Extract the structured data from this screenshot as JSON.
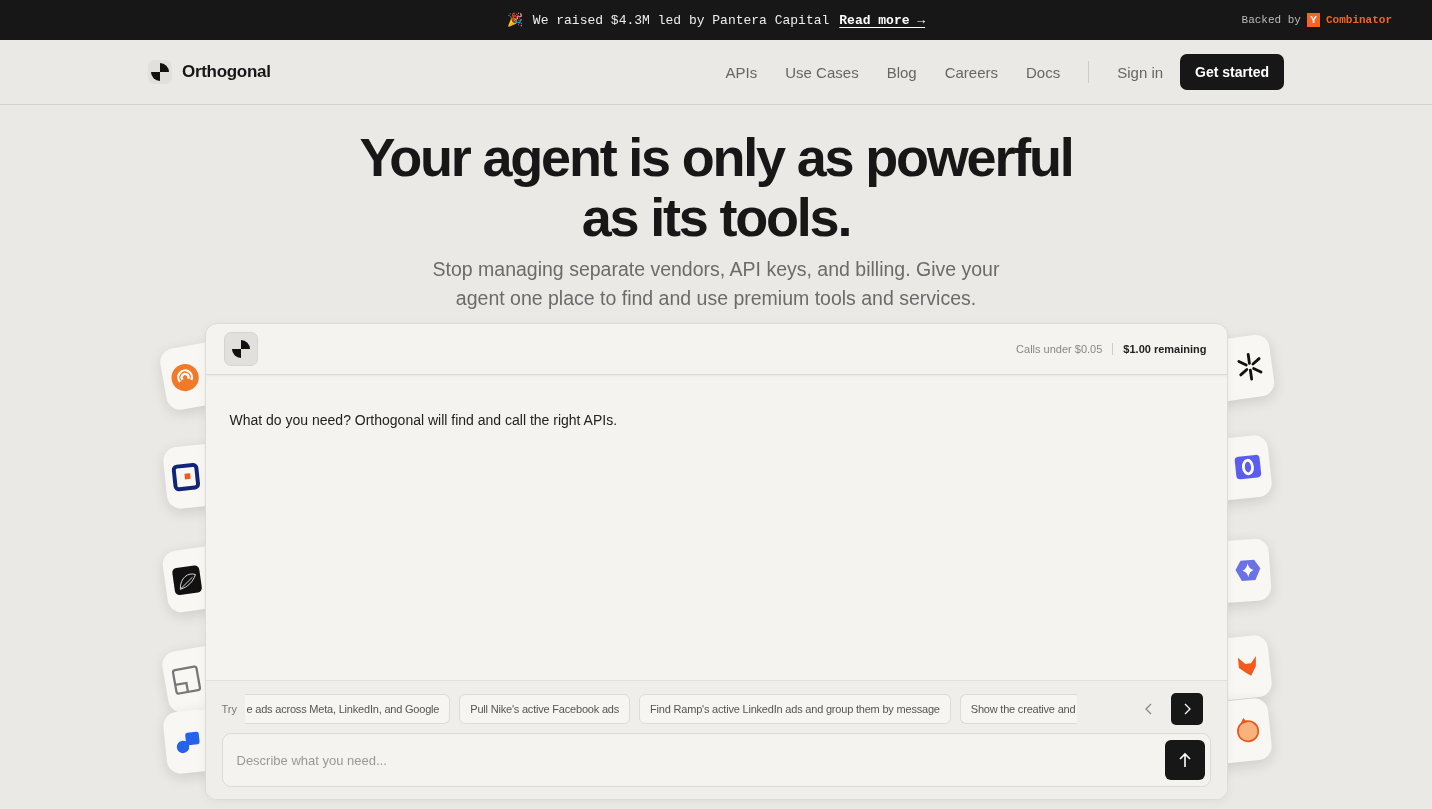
{
  "announcement": {
    "emoji": "🎉",
    "text": "We raised $4.3M led by Pantera Capital",
    "link": "Read more →",
    "backed_by": "Backed by",
    "badge": "Y",
    "partner": "Combinator"
  },
  "nav": {
    "brand": "Orthogonal",
    "links": [
      "APIs",
      "Use Cases",
      "Blog",
      "Careers",
      "Docs"
    ],
    "sign_in": "Sign in",
    "cta": "Get started"
  },
  "hero": {
    "title": "Your agent is only as powerful as its tools.",
    "subtitle": "Stop managing separate vendors, API keys, and billing. Give your agent one place to find and use premium tools and services."
  },
  "tiles_left": [
    {
      "kind": "broadcast"
    },
    {
      "kind": "square"
    },
    {
      "kind": "leaf"
    },
    {
      "kind": "frame"
    },
    {
      "kind": "bubble"
    }
  ],
  "tiles_right": [
    {
      "kind": "asterisk"
    },
    {
      "kind": "ring"
    },
    {
      "kind": "star"
    },
    {
      "kind": "fox"
    },
    {
      "kind": "blob"
    }
  ],
  "chat": {
    "meta": "Calls under $0.05",
    "balance": "$1.00 remaining",
    "prompt": "What do you need? Orthogonal will find and call the right APIs.",
    "try_label": "Try",
    "suggestions": [
      "e ads across Meta, LinkedIn, and Google",
      "Pull Nike's active Facebook ads",
      "Find Ramp's active LinkedIn ads and group them by message",
      "Show the creative and"
    ],
    "placeholder": "Describe what you need..."
  }
}
